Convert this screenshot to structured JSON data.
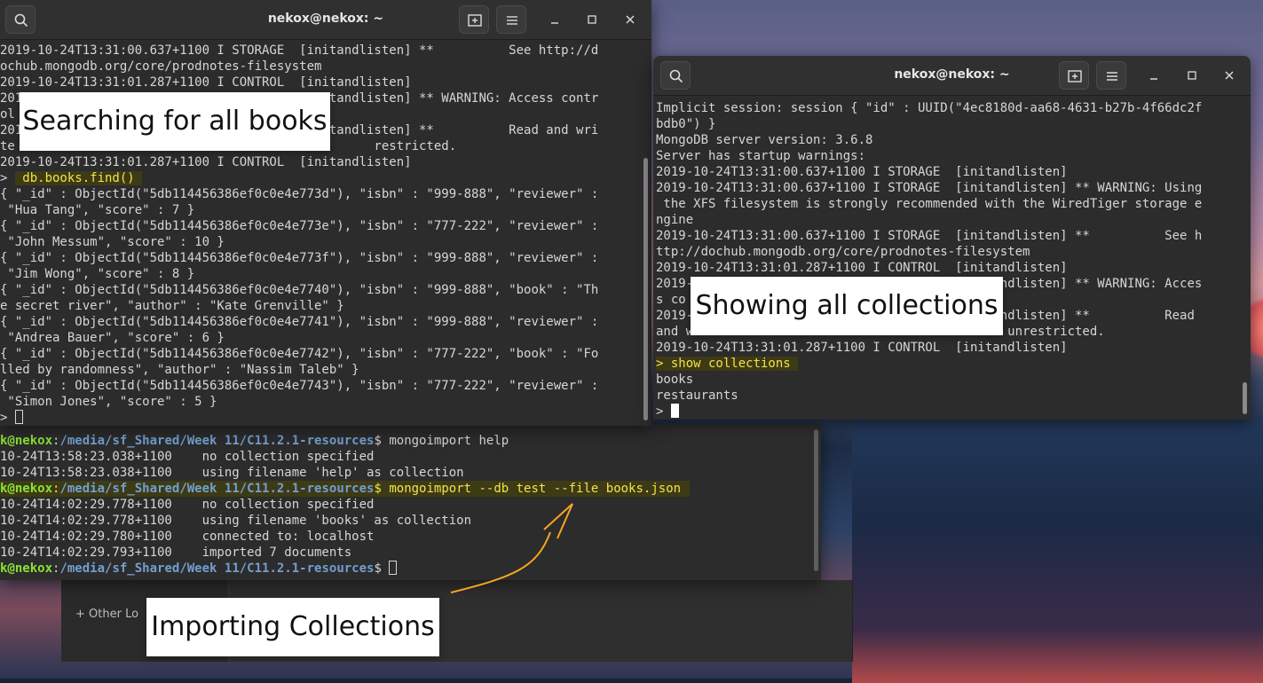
{
  "colors": {
    "terminal_bg": "#2c2c2c",
    "titlebar_bg": "#303030",
    "text": "#d6d6d6",
    "highlight_bg": "#3d3a16",
    "highlight_text": "#f2e44a",
    "prompt_user": "#8ae234",
    "prompt_path": "#729fcf",
    "arrow": "#f5a623"
  },
  "icons": {
    "search": "search-icon",
    "new_tab": "new-tab-icon",
    "menu": "hamburger-menu-icon",
    "minimize": "minimize-icon",
    "maximize": "maximize-icon",
    "close": "close-icon"
  },
  "left_window": {
    "title": "nekox@nekox: ~",
    "lines": [
      "2019-10-24T13:31:00.637+1100 I STORAGE  [initandlisten] **          See http://d",
      "ochub.mongodb.org/core/prodnotes-filesystem",
      "2019-10-24T13:31:01.287+1100 I CONTROL  [initandlisten]",
      "2019-10-24T13:31:01.287+1100 I CONTROL  [initandlisten] ** WARNING: Access contr",
      "ol",
      "2019-10-24T13:31:01.287+1100 I CONTROL  [initandlisten] **          Read and wri",
      "te                                                restricted.",
      "2019-10-24T13:31:01.287+1100 I CONTROL  [initandlisten]",
      "> ",
      "{ \"_id\" : ObjectId(\"5db114456386ef0c0e4e773d\"), \"isbn\" : \"999-888\", \"reviewer\" :",
      " \"Hua Tang\", \"score\" : 7 }",
      "{ \"_id\" : ObjectId(\"5db114456386ef0c0e4e773e\"), \"isbn\" : \"777-222\", \"reviewer\" :",
      " \"John Messum\", \"score\" : 10 }",
      "{ \"_id\" : ObjectId(\"5db114456386ef0c0e4e773f\"), \"isbn\" : \"999-888\", \"reviewer\" :",
      " \"Jim Wong\", \"score\" : 8 }",
      "{ \"_id\" : ObjectId(\"5db114456386ef0c0e4e7740\"), \"isbn\" : \"999-888\", \"book\" : \"Th",
      "e secret river\", \"author\" : \"Kate Grenville\" }",
      "{ \"_id\" : ObjectId(\"5db114456386ef0c0e4e7741\"), \"isbn\" : \"999-888\", \"reviewer\" :",
      " \"Andrea Bauer\", \"score\" : 6 }",
      "{ \"_id\" : ObjectId(\"5db114456386ef0c0e4e7742\"), \"isbn\" : \"777-222\", \"book\" : \"Fo",
      "lled by randomness\", \"author\" : \"Nassim Taleb\" }",
      "{ \"_id\" : ObjectId(\"5db114456386ef0c0e4e7743\"), \"isbn\" : \"777-222\", \"reviewer\" :",
      " \"Simon Jones\", \"score\" : 5 }",
      "> "
    ],
    "command": "db.books.find()"
  },
  "right_window": {
    "title": "nekox@nekox: ~",
    "lines": [
      "Implicit session: session { \"id\" : UUID(\"4ec8180d-aa68-4631-b27b-4f66dc2f",
      "bdb0\") }",
      "MongoDB server version: 3.6.8",
      "Server has startup warnings:",
      "2019-10-24T13:31:00.637+1100 I STORAGE  [initandlisten]",
      "2019-10-24T13:31:00.637+1100 I STORAGE  [initandlisten] ** WARNING: Using",
      " the XFS filesystem is strongly recommended with the WiredTiger storage e",
      "ngine",
      "2019-10-24T13:31:00.637+1100 I STORAGE  [initandlisten] **          See h",
      "ttp://dochub.mongodb.org/core/prodnotes-filesystem",
      "2019-10-24T13:31:01.287+1100 I CONTROL  [initandlisten]",
      "2019-10-24T13:31:01.287+1100 I CONTROL  [initandlisten] ** WARNING: Acces",
      "s co                                                    ",
      "2019-10-24T13:31:01.287+1100 I CONTROL  [initandlisten] **          Read",
      "and w                                       is unrestricted.",
      "2019-10-24T13:31:01.287+1100 I CONTROL  [initandlisten]",
      "> show collections",
      "books",
      "restaurants",
      "> "
    ]
  },
  "back_window": {
    "user": "k@nekox",
    "path": "/media/sf_Shared/Week 11/C11.2.1-resources",
    "lines": [
      {
        "type": "prompt",
        "cmd": " mongoimport help"
      },
      {
        "type": "out",
        "text": "10-24T13:58:23.038+1100    no collection specified"
      },
      {
        "type": "out",
        "text": "10-24T13:58:23.038+1100    using filename 'help' as collection"
      },
      {
        "type": "prompt",
        "cmd": " mongoimport --db test --file books.json"
      },
      {
        "type": "out",
        "text": "10-24T14:02:29.778+1100    no collection specified"
      },
      {
        "type": "out",
        "text": "10-24T14:02:29.778+1100    using filename 'books' as collection"
      },
      {
        "type": "out",
        "text": "10-24T14:02:29.780+1100    connected to: localhost"
      },
      {
        "type": "out",
        "text": "10-24T14:02:29.793+1100    imported 7 documents"
      },
      {
        "type": "prompt",
        "cmd": " "
      }
    ]
  },
  "file_manager": {
    "other_locations": "+ Other Lo"
  },
  "callouts": {
    "searching": "Searching for all books",
    "showing": "Showing all collections",
    "importing": "Importing Collections"
  }
}
